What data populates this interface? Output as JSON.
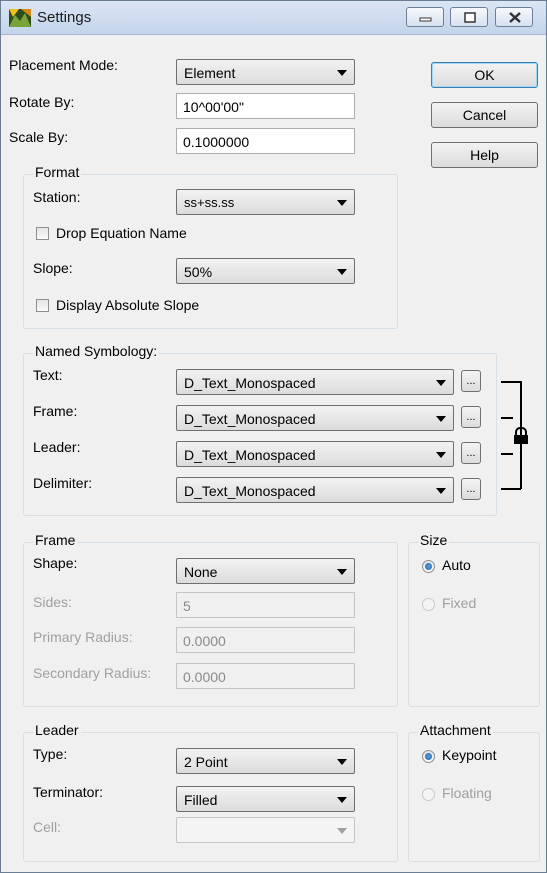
{
  "window": {
    "title": "Settings"
  },
  "general": {
    "placement_mode_label": "Placement Mode:",
    "placement_mode_value": "Element",
    "rotate_by_label": "Rotate By:",
    "rotate_by_value": "10^00'00\"",
    "scale_by_label": "Scale By:",
    "scale_by_value": "0.1000000"
  },
  "buttons": {
    "ok": "OK",
    "cancel": "Cancel",
    "help": "Help"
  },
  "format": {
    "legend": "Format",
    "station_label": "Station:",
    "station_value": "ss+ss.ss",
    "drop_equation_name": "Drop Equation Name",
    "drop_equation_checked": false,
    "slope_label": "Slope:",
    "slope_value": "50%",
    "display_absolute_slope": "Display Absolute Slope",
    "display_absolute_checked": false
  },
  "named_symbology": {
    "legend": "Named Symbology:",
    "rows": [
      {
        "label": "Text:",
        "value": "D_Text_Monospaced"
      },
      {
        "label": "Frame:",
        "value": "D_Text_Monospaced"
      },
      {
        "label": "Leader:",
        "value": "D_Text_Monospaced"
      },
      {
        "label": "Delimiter:",
        "value": "D_Text_Monospaced"
      }
    ],
    "browse_label": "..."
  },
  "frame": {
    "legend": "Frame",
    "shape_label": "Shape:",
    "shape_value": "None",
    "sides_label": "Sides:",
    "sides_value": "5",
    "primary_radius_label": "Primary Radius:",
    "primary_radius_value": "0.0000",
    "secondary_radius_label": "Secondary Radius:",
    "secondary_radius_value": "0.0000"
  },
  "size": {
    "legend": "Size",
    "auto_label": "Auto",
    "fixed_label": "Fixed",
    "selected": "Auto"
  },
  "leader": {
    "legend": "Leader",
    "type_label": "Type:",
    "type_value": "2 Point",
    "terminator_label": "Terminator:",
    "terminator_value": "Filled",
    "cell_label": "Cell:",
    "cell_value": ""
  },
  "attachment": {
    "legend": "Attachment",
    "keypoint_label": "Keypoint",
    "floating_label": "Floating",
    "selected": "Keypoint"
  },
  "icons": {
    "app": "settings-app-icon",
    "minimize": "minimize-icon",
    "maximize": "maximize-icon",
    "close": "close-icon",
    "lock": "lock-icon",
    "dropdown": "chevron-down-icon"
  },
  "colors": {
    "titlebar": "#c3d4ea",
    "window_bg": "#f0f0f0",
    "radio_dot": "#1d5fa8"
  }
}
